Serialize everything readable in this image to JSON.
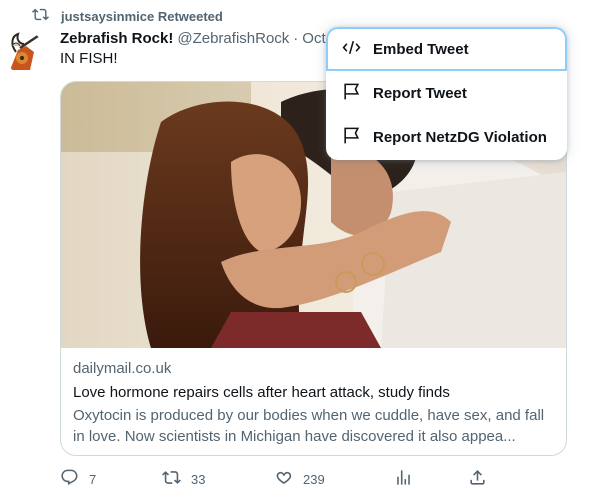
{
  "retweet": {
    "label": "justsaysinmice Retweeted",
    "icon": "retweet-icon"
  },
  "tweet": {
    "display_name": "Zebrafish Rock!",
    "handle": "@ZebrafishRock",
    "separator": "·",
    "date": "Oct",
    "text": "IN FISH!"
  },
  "card": {
    "domain": "dailymail.co.uk",
    "title": "Love hormone repairs cells after heart attack, study finds",
    "description": "Oxytocin is produced by our bodies when we cuddle, have sex, and fall in love. Now scientists in Michigan have discovered it also appea..."
  },
  "actions": {
    "replies": "7",
    "retweets": "33",
    "likes": "239"
  },
  "menu": {
    "items": [
      {
        "label": "Embed Tweet",
        "icon": "code-icon"
      },
      {
        "label": "Report Tweet",
        "icon": "flag-icon"
      },
      {
        "label": "Report NetzDG Violation",
        "icon": "flag-icon"
      }
    ]
  },
  "colors": {
    "text_primary": "#0f1419",
    "text_secondary": "#536471",
    "border": "#cfd9de",
    "focus_ring": "#8ecdf8"
  }
}
